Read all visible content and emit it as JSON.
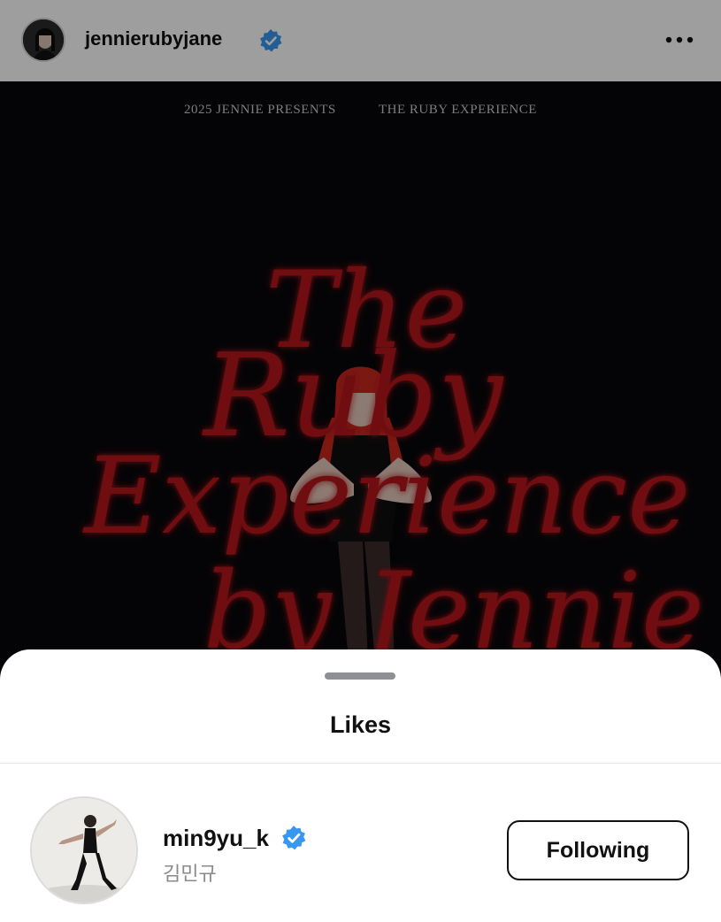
{
  "post": {
    "username": "jennierubyjane",
    "avatar_icon": "profile-photo",
    "more_icon": "more-horizontal-icon"
  },
  "poster": {
    "top_left": "2025 JENNIE PRESENTS",
    "top_right": "THE RUBY EXPERIENCE",
    "title_line1": "The",
    "title_line2": "Ruby",
    "title_line3": "Experience",
    "title_line4": "by Jennie"
  },
  "sheet": {
    "title": "Likes",
    "likes": [
      {
        "username": "min9yu_k",
        "full_name": "김민규",
        "verified": true,
        "button_label": "Following"
      }
    ]
  },
  "colors": {
    "verified_blue": "#3897f0",
    "poster_red": "#b3161c",
    "poster_bg": "#07070a"
  }
}
